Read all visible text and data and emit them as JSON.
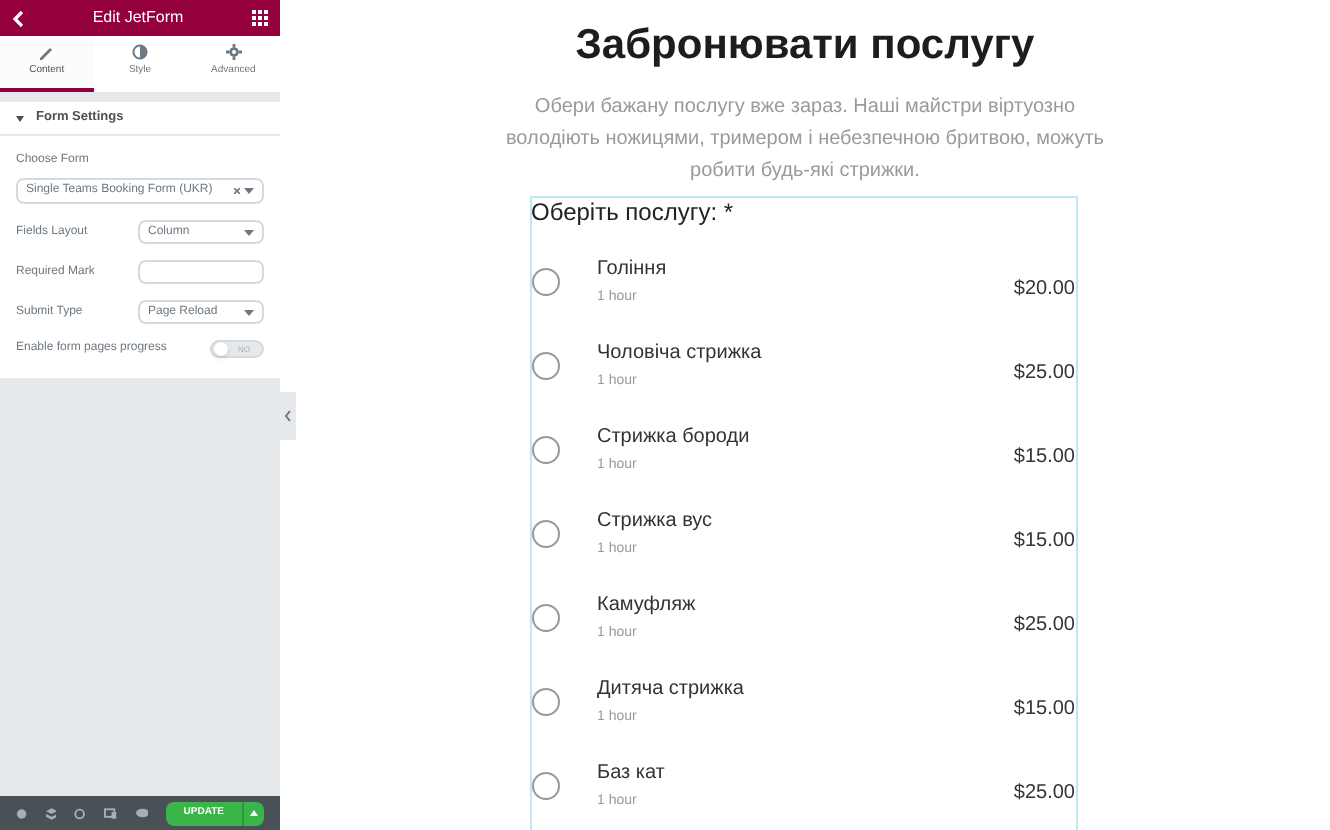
{
  "panel": {
    "title": "Edit JetForm",
    "tabs": [
      {
        "label": "Content",
        "selected": true
      },
      {
        "label": "Style",
        "selected": false
      },
      {
        "label": "Advanced",
        "selected": false
      }
    ],
    "section": {
      "title": "Form Settings",
      "expanded": true
    },
    "choose_form": {
      "label": "Choose Form",
      "value": "Single Teams Booking Form (UKR)"
    },
    "fields": [
      {
        "kind": "select",
        "label": "Fields Layout",
        "value": "Column"
      },
      {
        "kind": "input",
        "label": "Required Mark"
      },
      {
        "kind": "select",
        "label": "Submit Type",
        "value": "Page Reload"
      },
      {
        "kind": "toggle",
        "label": "Enable form pages progress",
        "on": false,
        "text": "NO"
      }
    ],
    "footer": {
      "button": "UPDATE"
    }
  },
  "page": {
    "title": "Забронювати послугу",
    "description": "Обери бажану послугу вже зараз. Наші майстри віртуозно володіють ножицями, тримером і небезпечною бритвою, можуть робити будь-які стрижки.",
    "question": "Оберіть послугу: *",
    "services": [
      {
        "name": "Гоління",
        "duration": "1 hour",
        "price": "$20.00",
        "selected": false
      },
      {
        "name": "Чоловіча стрижка",
        "duration": "1 hour",
        "price": "$25.00",
        "selected": false
      },
      {
        "name": "Стрижка бороди",
        "duration": "1 hour",
        "price": "$15.00",
        "selected": false
      },
      {
        "name": "Стрижка вус",
        "duration": "1 hour",
        "price": "$15.00",
        "selected": false
      },
      {
        "name": "Камуфляж",
        "duration": "1 hour",
        "price": "$25.00",
        "selected": false
      },
      {
        "name": "Дитяча стрижка",
        "duration": "1 hour",
        "price": "$15.00",
        "selected": false
      },
      {
        "name": "Баз кат",
        "duration": "1 hour",
        "price": "$25.00",
        "selected": false
      }
    ]
  }
}
